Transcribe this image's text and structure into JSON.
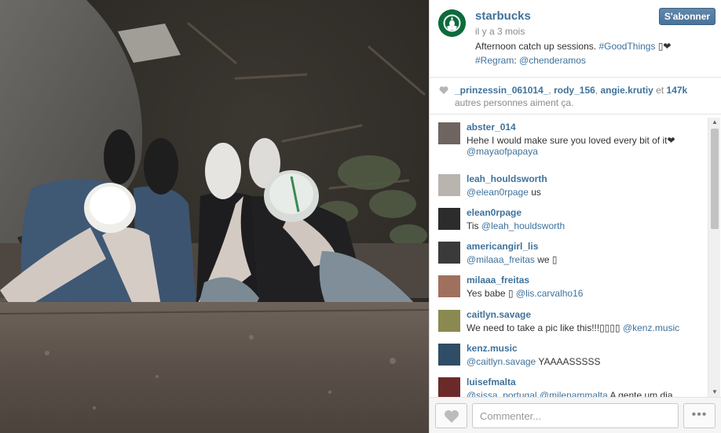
{
  "post": {
    "username": "starbucks",
    "time_ago": "il y a 3 mois",
    "follow_label": "S'abonner",
    "caption_text": "Afternoon catch up sessions. ",
    "caption_tag1": "#GoodThings",
    "caption_emoji": " ▯❤",
    "caption_regram": "#Regram",
    "caption_colon": ": ",
    "caption_mention": "@chenderamos"
  },
  "likes": {
    "user1": "_prinzessin_061014_",
    "sep1": ", ",
    "user2": "rody_156",
    "sep2": ", ",
    "user3": "angie.krutiy",
    "and": " et ",
    "count": "147k",
    "rest": "autres personnes aiment ça."
  },
  "comments": [
    {
      "user": "abster_014",
      "text": "Hehe I would make sure you loved every bit of it❤",
      "text2": "",
      "mention": "",
      "line2_mention": "@mayaofpapaya",
      "avatar_color": "#6e6460"
    },
    {
      "user": "leah_houldsworth",
      "text": "",
      "mention": "@elean0rpage",
      "text2": " us",
      "avatar_color": "#b9b4ae"
    },
    {
      "user": "elean0rpage",
      "text": "Tis ",
      "mention": "@leah_houldsworth",
      "text2": "",
      "avatar_color": "#2c2c2c"
    },
    {
      "user": "americangirl_lis",
      "text": "",
      "mention": "@milaaa_freitas",
      "text2": " we ▯",
      "avatar_color": "#3a3a3a"
    },
    {
      "user": "milaaa_freitas",
      "text": "Yes babe ▯ ",
      "mention": "@lis.carvalho16",
      "text2": "",
      "avatar_color": "#a0705e"
    },
    {
      "user": "caitlyn.savage",
      "text": "We need to take a pic like this!!!▯▯▯▯ ",
      "mention": "@kenz.music",
      "text2": "",
      "avatar_color": "#8a8a50"
    },
    {
      "user": "kenz.music",
      "text": "",
      "mention": "@caitlyn.savage",
      "text2": " YAAAASSSSS",
      "avatar_color": "#2f4d66"
    },
    {
      "user": "luisefmalta",
      "text": "",
      "mention": "@sissa_portugal @milenammalta",
      "text2": " A gente um dia.",
      "avatar_color": "#6b2a2a"
    }
  ],
  "footer": {
    "comment_placeholder": "Commenter...",
    "more_label": "•••"
  },
  "colors": {
    "link": "#3f729b",
    "starbucks_green": "#0d6b3c"
  }
}
